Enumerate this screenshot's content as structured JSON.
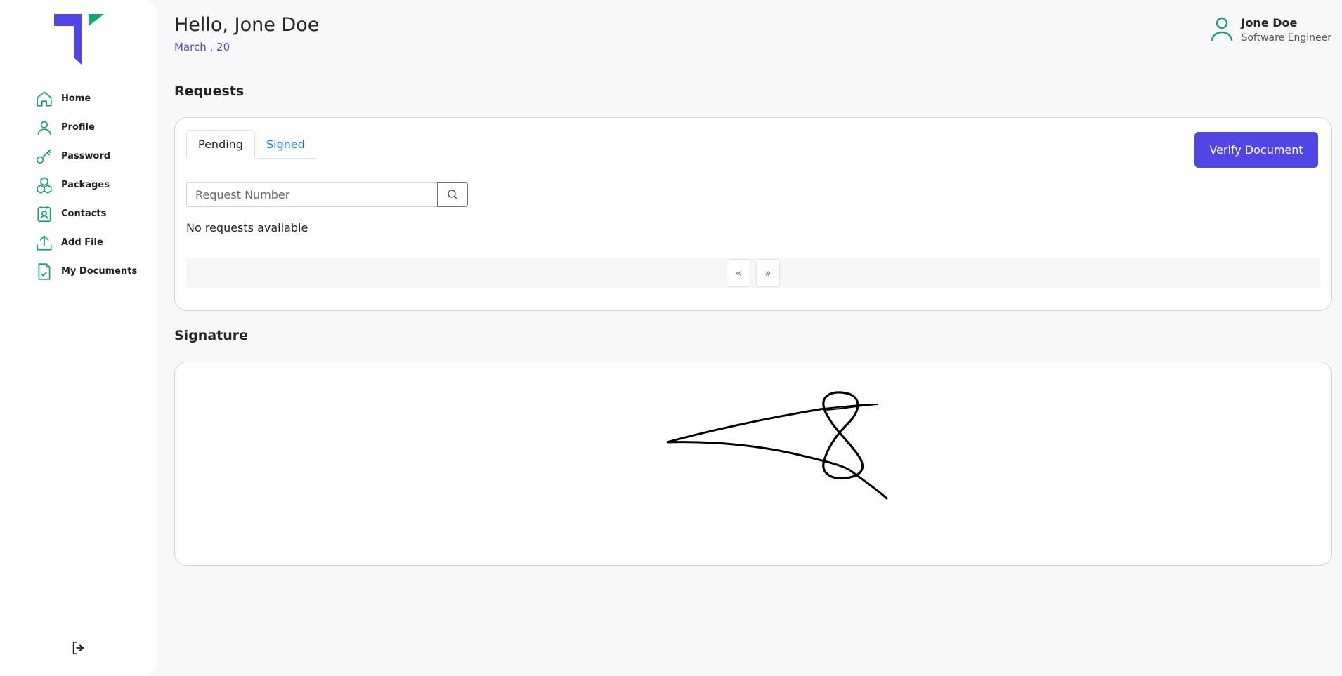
{
  "app": {
    "logo": "brand-logo",
    "colors": {
      "accent": "#4f46e5",
      "icon": "#14a37f",
      "link": "#0d6efd"
    }
  },
  "sidebar": {
    "items": [
      {
        "label": "Home",
        "icon": "home-icon"
      },
      {
        "label": "Profile",
        "icon": "user-icon"
      },
      {
        "label": "Password",
        "icon": "key-icon"
      },
      {
        "label": "Packages",
        "icon": "packages-icon"
      },
      {
        "label": "Contacts",
        "icon": "contacts-icon"
      },
      {
        "label": "Add File",
        "icon": "upload-icon"
      },
      {
        "label": "My Documents",
        "icon": "document-check-icon"
      }
    ],
    "logout_icon": "logout-icon"
  },
  "header": {
    "greeting": "Hello, Jone Doe",
    "date": "March , 20",
    "user_name": "Jone Doe",
    "user_role": "Software Engineer"
  },
  "requests": {
    "title": "Requests",
    "tabs": [
      {
        "label": "Pending",
        "active": true
      },
      {
        "label": "Signed",
        "active": false
      }
    ],
    "verify_button": "Verify Document",
    "search_placeholder": "Request Number",
    "empty_message": "No requests available",
    "pager": {
      "prev": "«",
      "next": "»"
    }
  },
  "signature": {
    "title": "Signature"
  }
}
